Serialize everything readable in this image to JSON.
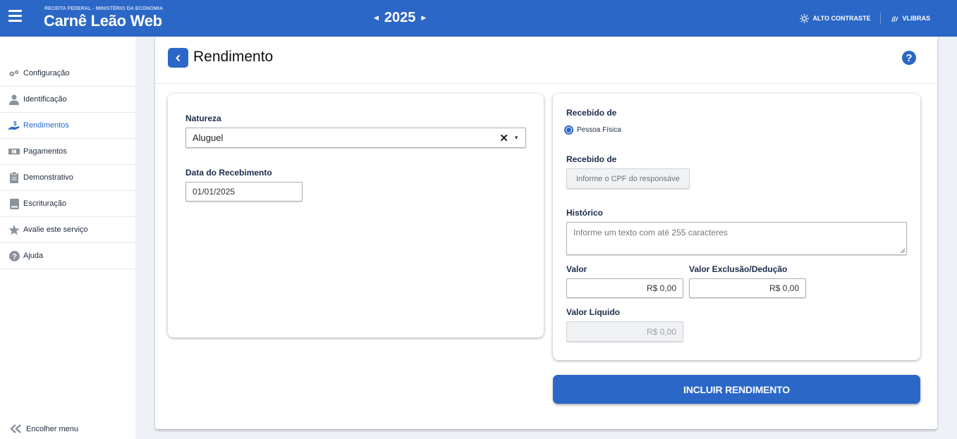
{
  "header": {
    "ministry": "RECEITA FEDERAL - MINISTÉRIO DA ECONOMIA",
    "title": "Carnê Leão Web",
    "year": "2025",
    "high_contrast": "ALTO CONTRASTE",
    "vlibras": "VLIBRAS"
  },
  "sidebar": {
    "items": [
      {
        "label": "Configuração",
        "icon": "gears-icon"
      },
      {
        "label": "Identificação",
        "icon": "user-icon"
      },
      {
        "label": "Rendimentos",
        "icon": "hand-dollar-icon"
      },
      {
        "label": "Pagamentos",
        "icon": "money-icon"
      },
      {
        "label": "Demonstrativo",
        "icon": "clipboard-icon"
      },
      {
        "label": "Escrituração",
        "icon": "book-icon"
      },
      {
        "label": "Avalie este serviço",
        "icon": "star-icon"
      },
      {
        "label": "Ajuda",
        "icon": "question-icon"
      }
    ],
    "collapse_label": "Encolher menu"
  },
  "page": {
    "title": "Rendimento"
  },
  "left_card": {
    "natureza_label": "Natureza",
    "natureza_value": "Aluguel",
    "data_label": "Data do Recebimento",
    "data_value": "01/01/2025"
  },
  "right_card": {
    "recebido_label": "Recebido de",
    "radio_label": "Pessoa Física",
    "recebido_label2": "Recebido de",
    "cpf_placeholder": "Informe o CPF do responsáve",
    "historico_label": "Histórico",
    "historico_placeholder": "Informe um texto com até 255 caracteres",
    "valor_label": "Valor",
    "valor_value": "R$ 0,00",
    "exclusao_label": "Valor Exclusão/Dedução",
    "exclusao_value": "R$ 0,00",
    "liquido_label": "Valor Líquido",
    "liquido_value": "R$ 0,00"
  },
  "submit_label": "INCLUIR RENDIMENTO",
  "colors": {
    "primary": "#2b67c6",
    "background": "#eef1f6"
  }
}
